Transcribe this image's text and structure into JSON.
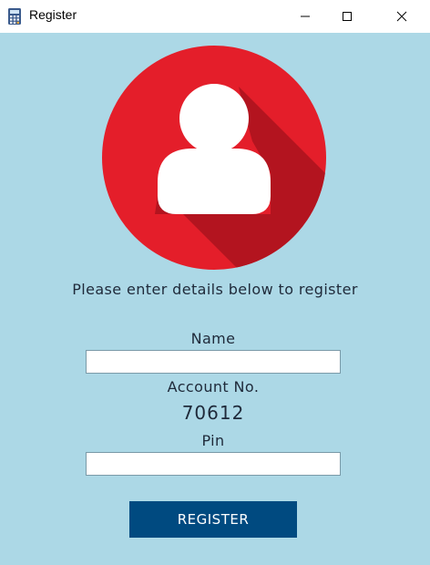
{
  "window": {
    "title": "Register",
    "icon": "calculator-icon",
    "controls": [
      "minimize-icon",
      "maximize-icon",
      "close-icon"
    ]
  },
  "form": {
    "avatar_icon": "user-avatar-icon",
    "instruction": "Please enter details below to register",
    "name_label": "Name",
    "name_value": "",
    "account_label": "Account No.",
    "account_value": "70612",
    "pin_label": "Pin",
    "pin_value": "",
    "register_label": "REGISTER"
  },
  "colors": {
    "background": "#acd8e6",
    "avatar_circle": "#e41e2a",
    "avatar_shadow": "#b3141f",
    "button": "#004a80"
  }
}
